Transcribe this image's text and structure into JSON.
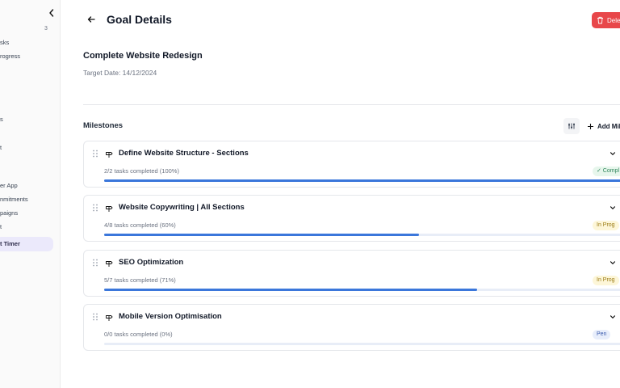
{
  "sidebar": {
    "count": "3",
    "items": [
      {
        "label": "sks"
      },
      {
        "label": "rogress"
      },
      {
        "label": "s"
      },
      {
        "label": "t"
      },
      {
        "label": "er App"
      },
      {
        "label": "nmitments"
      },
      {
        "label": "paigns"
      },
      {
        "label": "t"
      },
      {
        "label": "t Timer"
      }
    ]
  },
  "header": {
    "title": "Goal Details",
    "delete_label": "Dele"
  },
  "goal": {
    "title": "Complete Website Redesign",
    "target_date": "Target Date: 14/12/2024"
  },
  "milestones_section": {
    "heading": "Milestones",
    "add_label": "Add Mil"
  },
  "milestones": [
    {
      "title": "Define Website Structure - Sections",
      "progress_text": "2/2 tasks completed (100%)",
      "progress": 1.0,
      "status": "✓ Compl",
      "status_bg": "#e7f6ec",
      "status_color": "#2f855a"
    },
    {
      "title": "Website Copywriting | All Sections",
      "progress_text": "4/8 tasks completed (60%)",
      "progress": 0.6,
      "status": "In Prog",
      "status_bg": "#fdf6d8",
      "status_color": "#9a7b14"
    },
    {
      "title": "SEO Optimization",
      "progress_text": "5/7 tasks completed (71%)",
      "progress": 0.71,
      "status": "In Prog",
      "status_bg": "#fdf6d8",
      "status_color": "#9a7b14"
    },
    {
      "title": "Mobile Version Optimisation",
      "progress_text": "0/0 tasks completed (0%)",
      "progress": 0,
      "status": "Pen",
      "status_bg": "#e8eefb",
      "status_color": "#3b5bad"
    }
  ],
  "colors": {
    "accent": "#3b77db",
    "danger": "#e8474a",
    "sidebar_active": "#ebe9fb"
  },
  "icons": {
    "back": "arrow-left-icon",
    "delete": "trash-icon",
    "collapse": "chevron-left-icon",
    "filter": "sliders-icon",
    "add": "plus-icon",
    "drag": "grip-icon",
    "milestone": "signpost-icon",
    "expand": "chevron-down-icon"
  }
}
